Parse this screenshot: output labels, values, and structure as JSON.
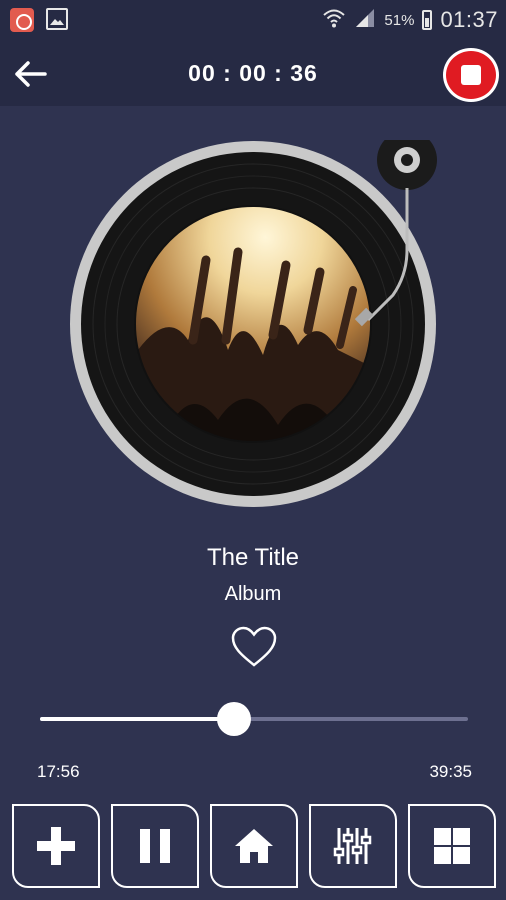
{
  "status_bar": {
    "battery_percent": "51%",
    "clock": "01:37",
    "icons": [
      "recorder-app-icon",
      "gallery-icon",
      "wifi-icon",
      "signal-icon",
      "battery-icon"
    ]
  },
  "header": {
    "elapsed": "00 : 00 : 36",
    "back_icon": "arrow-left-icon",
    "stop_icon": "stop-icon",
    "stop_color": "#e01b22"
  },
  "track": {
    "title": "The Title",
    "album": "Album",
    "favorite_icon": "heart-outline-icon",
    "artwork": "concert crowd with raised hands"
  },
  "playback": {
    "current_time": "17:56",
    "total_time": "39:35",
    "progress": 0.453
  },
  "controls": [
    {
      "icon": "plus-icon"
    },
    {
      "icon": "pause-icon"
    },
    {
      "icon": "home-icon"
    },
    {
      "icon": "equalizer-icon"
    },
    {
      "icon": "grid-icon"
    }
  ],
  "colors": {
    "background": "#2f3350",
    "bar": "#262a44",
    "accent": "#e01b22"
  }
}
